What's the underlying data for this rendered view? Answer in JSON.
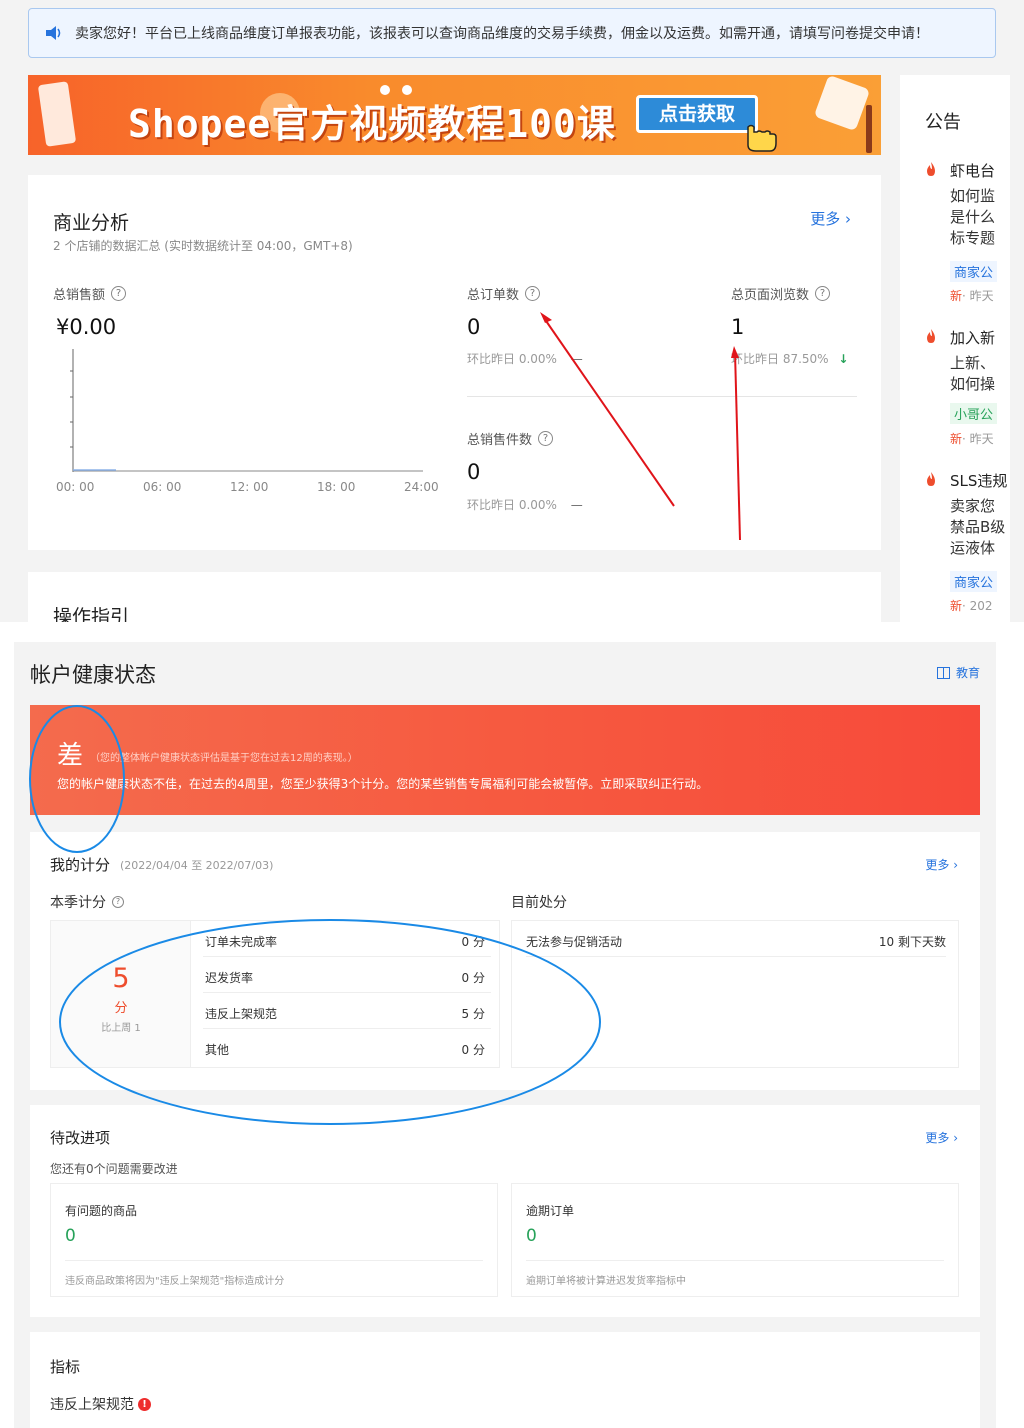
{
  "notice": {
    "text": "卖家您好！平台已上线商品维度订单报表功能，该报表可以查询商品维度的交易手续费，佣金以及运费。如需开通，请填写问卷提交申请！"
  },
  "banner": {
    "title": "Shopee官方视频教程100课",
    "button": "点击获取"
  },
  "business": {
    "title": "商业分析",
    "subtitle": "2 个店铺的数据汇总 (实时数据统计至 04:00，GMT+8)",
    "more": "更多",
    "sales_label": "总销售额",
    "sales_value": "¥0.00",
    "orders_label": "总订单数",
    "orders_value": "0",
    "orders_compare": "环比昨日 0.00%",
    "orders_compare_mark": "—",
    "views_label": "总页面浏览数",
    "views_value": "1",
    "views_compare": "环比昨日 87.50%",
    "items_label": "总销售件数",
    "items_value": "0",
    "items_compare": "环比昨日 0.00%",
    "items_compare_mark": "—",
    "x_ticks": [
      "00: 00",
      "06: 00",
      "12: 00",
      "18: 00",
      "24:00"
    ]
  },
  "announcements": {
    "title": "公告",
    "items": [
      {
        "title": "虾电台",
        "lines": [
          "如何监",
          "是什么",
          "标专题"
        ],
        "tag": "商家公",
        "tag_color": "#2673dd",
        "new": "新",
        "date": "· 昨天"
      },
      {
        "title": "加入新",
        "lines": [
          "上新、",
          "如何操"
        ],
        "tag": "小哥公",
        "tag_color": "#27a25a",
        "new": "新",
        "date": "· 昨天"
      },
      {
        "title": "SLS违规",
        "lines": [
          "卖家您",
          "禁品B级",
          "运液体"
        ],
        "tag": "商家公",
        "tag_color": "#2673dd",
        "new": "新",
        "date": "· 202"
      }
    ]
  },
  "ops": {
    "title": "操作指引"
  },
  "health": {
    "title": "帐户健康状态",
    "edu": "教育",
    "grade": "差",
    "grade_note": "（您的整体帐户健康状态评估是基于您在过去12周的表现。）",
    "grade_desc": "您的帐户健康状态不佳，在过去的4周里，您至少获得3个计分。您的某些销售专属福利可能会被暂停。立即采取纠正行动。",
    "score_title": "我的计分",
    "score_period": "(2022/04/04 至 2022/07/03)",
    "score_more": "更多",
    "season_label": "本季计分",
    "current_label": "目前处分",
    "score_value": "5",
    "score_unit": "分",
    "score_compare": "比上周 1",
    "rows": [
      {
        "name": "订单未完成率",
        "value": "0 分"
      },
      {
        "name": "迟发货率",
        "value": "0 分"
      },
      {
        "name": "违反上架规范",
        "value": "5 分"
      },
      {
        "name": "其他",
        "value": "0 分"
      }
    ],
    "penalty": {
      "name": "无法参与促销活动",
      "value": "10 剩下天数"
    }
  },
  "todo": {
    "title": "待改进项",
    "more": "更多",
    "sub": "您还有0个问题需要改进",
    "boxes": [
      {
        "title": "有问题的商品",
        "value": "0",
        "note": "违反商品政策将因为\"违反上架规范\"指标造成计分"
      },
      {
        "title": "逾期订单",
        "value": "0",
        "note": "逾期订单将被计算进迟发货率指标中"
      }
    ]
  },
  "metrics": {
    "title": "指标",
    "item": "违反上架规范",
    "warn": "!"
  },
  "colors": {
    "accent": "#ee4d2d",
    "link": "#2673dd",
    "good": "#27a25a",
    "annotation_red": "#e0141a",
    "annotation_blue": "#1a8ae6"
  }
}
